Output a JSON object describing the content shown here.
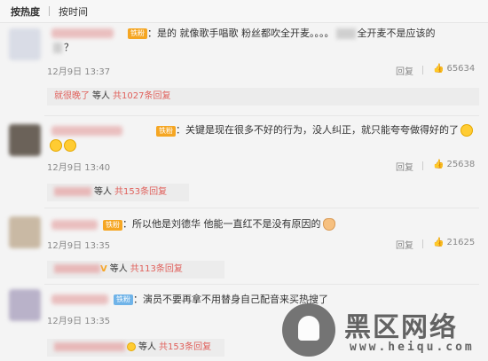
{
  "sort_tabs": [
    {
      "label": "按热度",
      "active": true
    },
    {
      "label": "按时间",
      "active": false
    }
  ],
  "comments": [
    {
      "badge": "铁粉",
      "text_a": "：是的 就像歌手唱歌  粉丝都吹全开麦。。。。",
      "text_b": "全开麦不是应该的",
      "text_line2": "？",
      "time": "12月9日 13:37",
      "reply_label": "回复",
      "likes": "65634",
      "reply_bar": {
        "name": "就很晚了",
        "others": "等人",
        "link": "共1027条回复"
      }
    },
    {
      "badge": "铁粉",
      "text_a": "：关键是现在很多不好的行为，没人纠正，就只能夸夸做得好的了",
      "time": "12月9日 13:40",
      "reply_label": "回复",
      "likes": "25638",
      "reply_bar": {
        "others": "等人",
        "link": "共153条回复"
      }
    },
    {
      "badge": "铁粉",
      "text_a": "：所以他是刘德华 他能一直红不是没有原因的",
      "time": "12月9日 13:35",
      "reply_label": "回复",
      "likes": "21625",
      "reply_bar": {
        "name_mark": "V",
        "others": "等人",
        "link": "共113条回复"
      }
    },
    {
      "badge": "铁粉",
      "text_a": "：演员不要再拿不用替身自己配音来买热搜了",
      "time": "12月9日 13:35",
      "reply_bar": {
        "others": "等人",
        "link": "共153条回复"
      }
    }
  ],
  "watermark": {
    "title": "黑区网络",
    "url": "www.heiqu.com"
  },
  "colors": {
    "link_red": "#e0605b",
    "badge_orange": "#f5a623",
    "badge_blue": "#6fb3e8"
  }
}
